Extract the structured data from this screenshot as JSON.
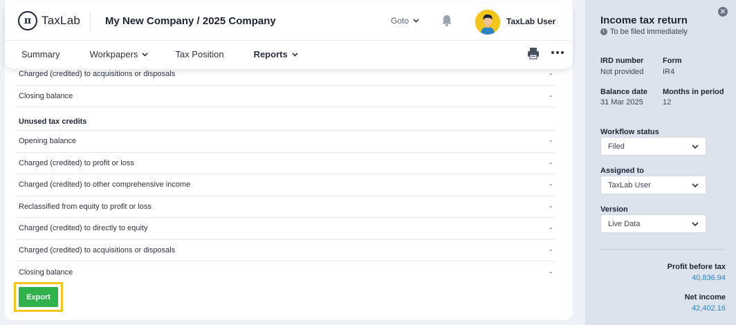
{
  "header": {
    "logo_symbol": "π",
    "logo_text": "TaxLab",
    "company": "My New Company / 2025 Company",
    "goto_label": "Goto",
    "user_name": "TaxLab User"
  },
  "nav": {
    "items": [
      {
        "label": "Summary"
      },
      {
        "label": "Workpapers"
      },
      {
        "label": "Tax Position"
      },
      {
        "label": "Reports"
      }
    ]
  },
  "table": {
    "top_rows": [
      {
        "label": "Charged (credited) to acquisitions or disposals",
        "value": "-"
      },
      {
        "label": "Closing balance",
        "value": "-"
      }
    ],
    "section_title": "Unused tax credits",
    "section_rows": [
      {
        "label": "Opening balance",
        "value": "-"
      },
      {
        "label": "Charged (credited) to profit or loss",
        "value": "-"
      },
      {
        "label": "Charged (credited) to other comprehensive income",
        "value": "-"
      },
      {
        "label": "Reclassified from equity to profit or loss",
        "value": "-"
      },
      {
        "label": "Charged (credited) to directly to equity",
        "value": "-"
      },
      {
        "label": "Charged (credited) to acquisitions or disposals",
        "value": "-"
      },
      {
        "label": "Closing balance",
        "value": "-"
      }
    ]
  },
  "export_label": "Export",
  "side": {
    "title": "Income tax return",
    "subtitle": "To be filed immediately",
    "ird_label": "IRD number",
    "ird_value": "Not provided",
    "form_label": "Form",
    "form_value": "IR4",
    "balance_label": "Balance date",
    "balance_value": "31 Mar 2025",
    "months_label": "Months in period",
    "months_value": "12",
    "workflow_label": "Workflow status",
    "workflow_value": "Filed",
    "assigned_label": "Assigned to",
    "assigned_value": "TaxLab User",
    "version_label": "Version",
    "version_value": "Live Data",
    "profit_label": "Profit before tax",
    "profit_value": "40,836.94",
    "net_label": "Net income",
    "net_value": "42,402.16"
  },
  "colors": {
    "export_green": "#2fb24a",
    "highlight_yellow": "#f5c518",
    "link_blue": "#2a84c6",
    "side_bg": "#dde3ec"
  }
}
